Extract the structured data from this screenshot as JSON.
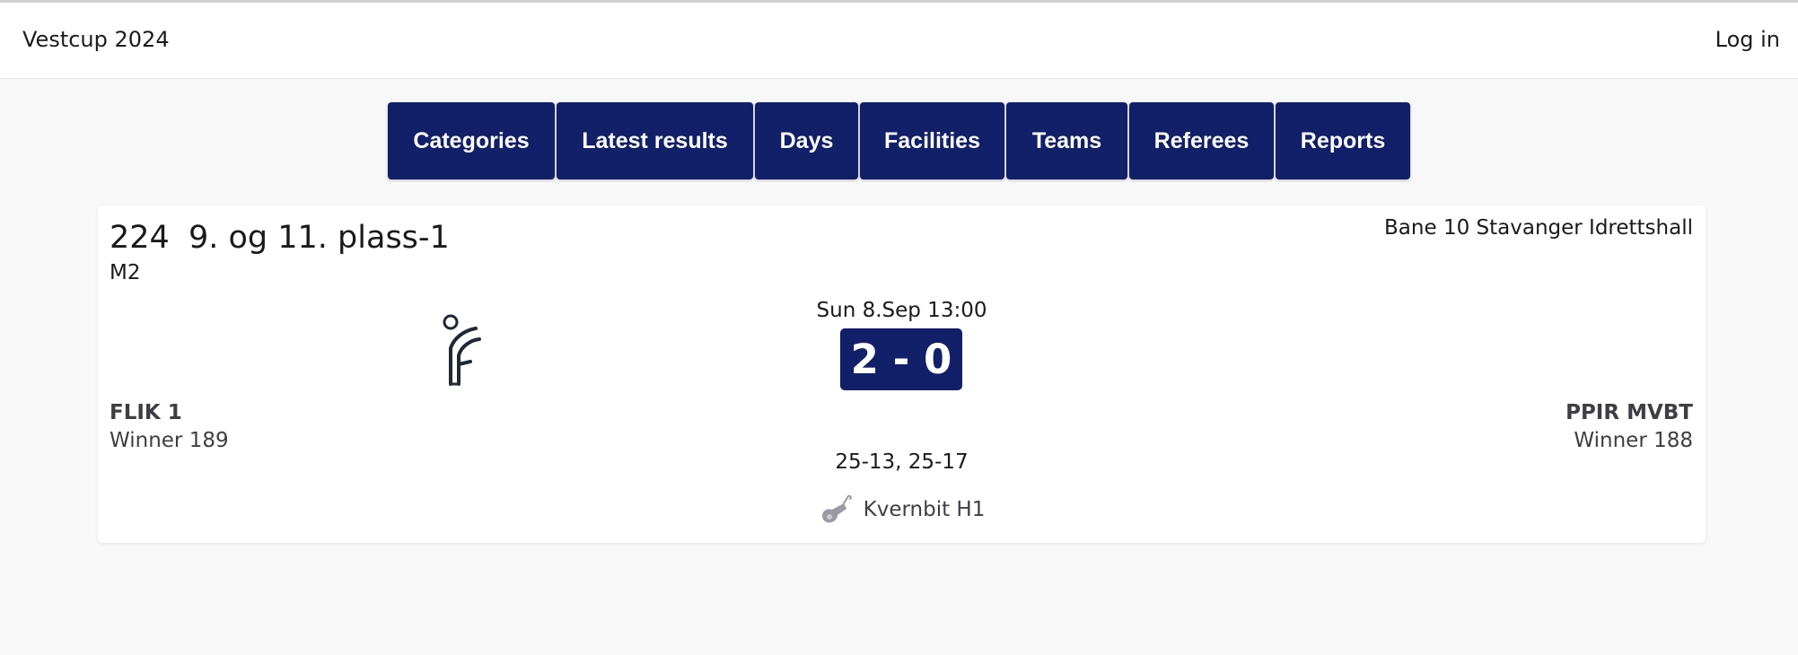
{
  "header": {
    "title": "Vestcup 2024",
    "login_label": "Log in"
  },
  "nav": {
    "tabs": [
      {
        "label": "Categories"
      },
      {
        "label": "Latest results"
      },
      {
        "label": "Days"
      },
      {
        "label": "Facilities"
      },
      {
        "label": "Teams"
      },
      {
        "label": "Referees"
      },
      {
        "label": "Reports"
      }
    ]
  },
  "match": {
    "number": "224",
    "name": "9. og 11. plass-1",
    "category": "M2",
    "venue": "Bane 10 Stavanger Idrettshall",
    "datetime": "Sun 8.Sep 13:00",
    "score": "2 - 0",
    "sets": "25-13, 25-17",
    "home": {
      "name": "FLIK 1",
      "sub": "Winner 189",
      "logo": "club-logo-icon"
    },
    "away": {
      "name": "PPIR MVBT",
      "sub": "Winner 188"
    },
    "referee": {
      "name": "Kvernbit H1",
      "icon": "whistle-icon"
    }
  },
  "colors": {
    "accent": "#121f69",
    "background": "#f8f8f8",
    "card": "#ffffff"
  }
}
